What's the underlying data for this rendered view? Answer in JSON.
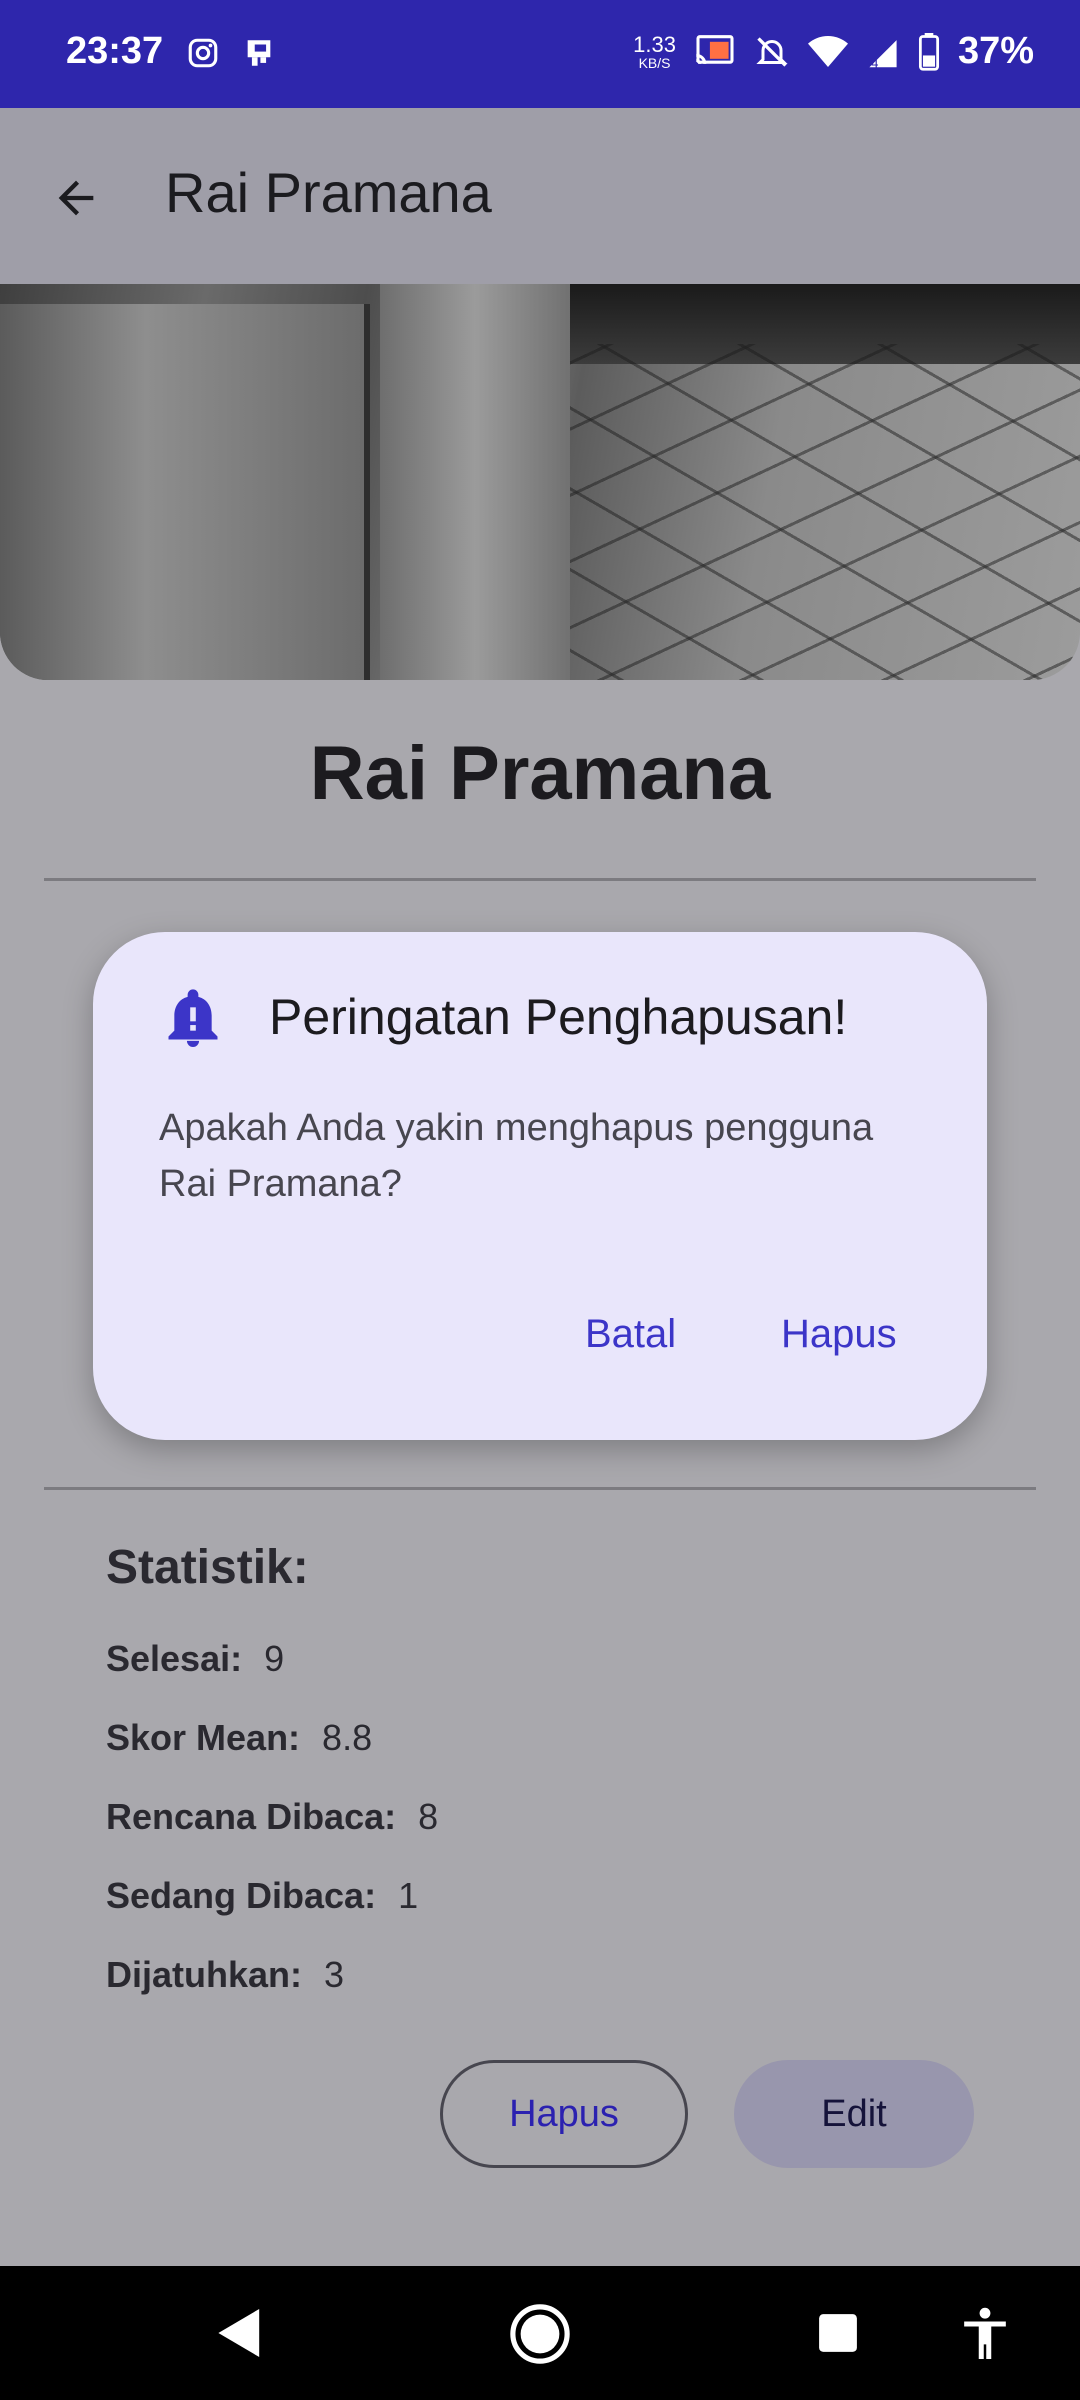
{
  "status_bar": {
    "time": "23:37",
    "net_speed_value": "1.33",
    "net_speed_unit": "KB/S",
    "battery": "37%",
    "icons": [
      "instagram-icon",
      "notification-icon",
      "cast-icon",
      "mute-icon",
      "wifi-icon",
      "signal-icon",
      "battery-icon"
    ]
  },
  "app_bar": {
    "title": "Rai Pramana",
    "back_icon": "arrow-back-icon"
  },
  "profile": {
    "name": "Rai Pramana"
  },
  "stats": {
    "title": "Statistik:",
    "rows": [
      {
        "label": "Selesai:",
        "value": "9"
      },
      {
        "label": "Skor Mean:",
        "value": "8.8"
      },
      {
        "label": "Rencana Dibaca:",
        "value": "8"
      },
      {
        "label": "Sedang Dibaca:",
        "value": "1"
      },
      {
        "label": "Dijatuhkan:",
        "value": "3"
      }
    ]
  },
  "actions": {
    "delete_label": "Hapus",
    "edit_label": "Edit"
  },
  "dialog": {
    "title": "Peringatan Penghapusan!",
    "message": "Apakah Anda yakin menghapus pengguna Rai Pramana?",
    "cancel_label": "Batal",
    "confirm_label": "Hapus",
    "icon": "notification-important-icon"
  },
  "colors": {
    "status_bar": "#2e26ac",
    "accent": "#3c35c8",
    "dialog_bg": "#e9e6fb",
    "scrim_bg": "#a9a8ad"
  }
}
